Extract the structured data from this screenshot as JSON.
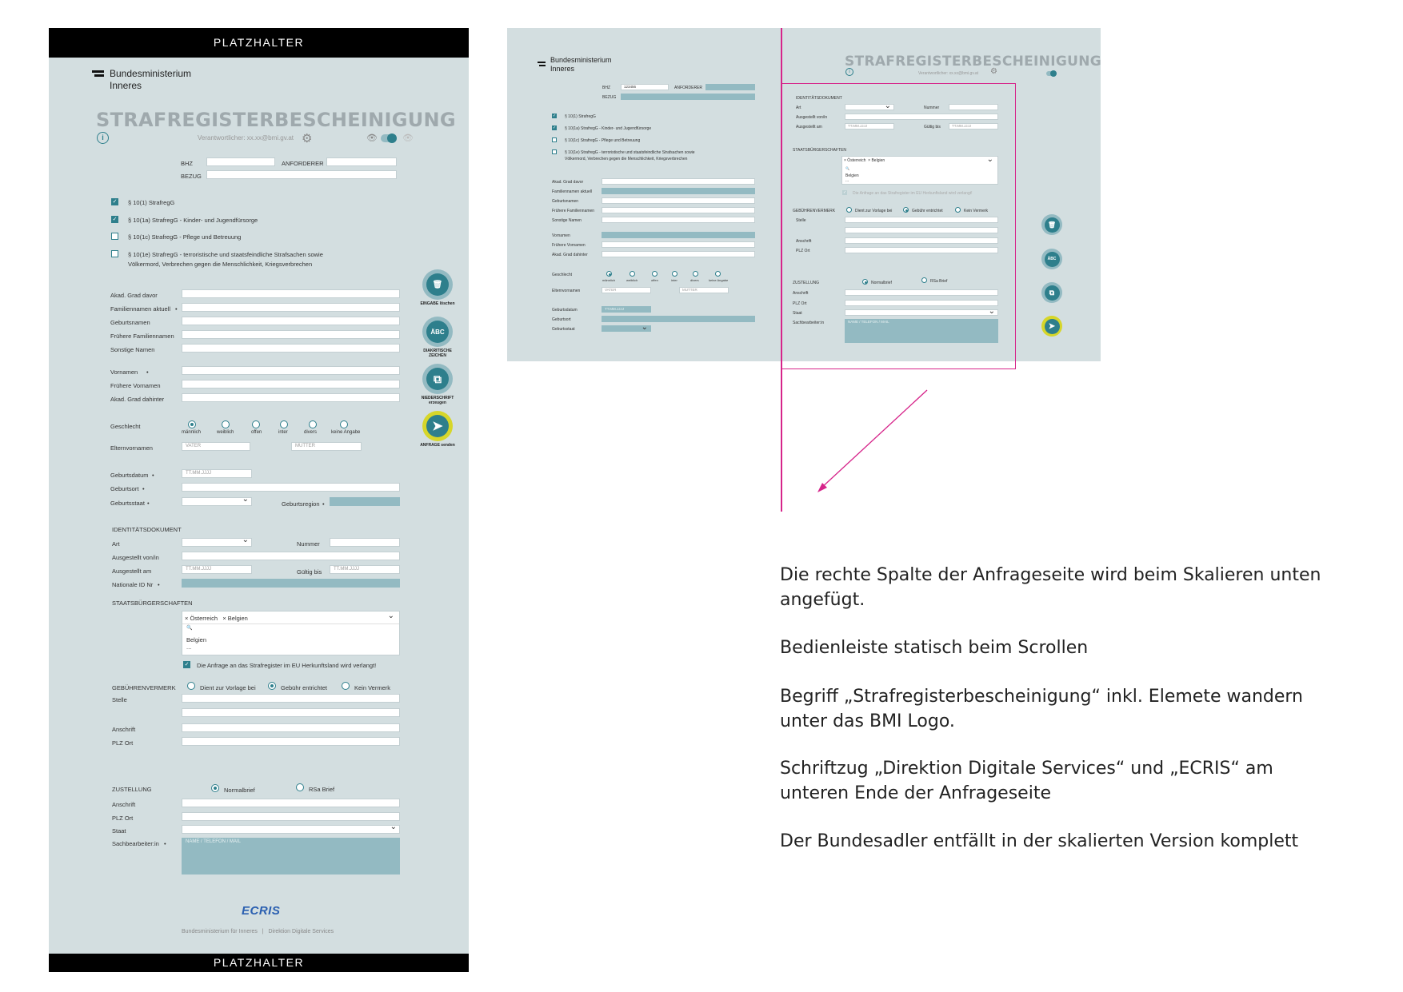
{
  "placeholder_top": "PLATZHALTER",
  "placeholder_bottom": "PLATZHALTER",
  "ministry": {
    "line1": "Bundesministerium",
    "line2": "Inneres"
  },
  "title": "STRAFREGISTERBESCHEINIGUNG",
  "responsible": "Verantwortlicher: xx.xx@bmi.gv.at",
  "small_responsible": "Verantwortlicher: xx.xx@bmi.gv.at",
  "header_fields": {
    "bhz": "BHZ",
    "anforderer": "ANFORDERER",
    "bezug": "BEZUG",
    "bhz_value": "123456"
  },
  "checkboxes": [
    {
      "label": "§ 10(1) StrafregG",
      "checked": true
    },
    {
      "label": "§ 10(1a) StrafregG - Kinder- und Jugendfürsorge",
      "checked": true
    },
    {
      "label": "§ 10(1c) StrafregG - Pflege und Betreuung",
      "checked": false
    },
    {
      "label": "§ 10(1e) StrafregG - terroristische und staatsfeindliche Strafsachen sowie",
      "label2": "Völkermord, Verbrechen gegen die Menschlichkeit, Kriegsverbrechen",
      "checked": false
    }
  ],
  "small_checkboxes": [
    "§ 10(1) StrafregG",
    "§ 10(1a) StrafregG - Kinder- und Jugendfürsorge",
    "§ 10(1c) StrafregG - Pflege und Betreuung",
    "§ 10(1e) StrafregG - terroristische und staatsfeindliche Strafsachen sowie",
    "Völkermord, Verbrechen gegen die Menschlichkeit, Kriegsverbrechen"
  ],
  "name_fields": [
    "Akad. Grad davor",
    "Familiennamen aktuell",
    "Geburtsnamen",
    "Frühere Familiennamen",
    "Sonstige Namen"
  ],
  "vor_fields": [
    "Vornamen",
    "Frühere Vornamen",
    "Akad. Grad dahinter"
  ],
  "gender": {
    "label": "Geschlecht",
    "options": [
      "männlich",
      "weiblich",
      "offen",
      "inter",
      "divers",
      "keine Angabe"
    ]
  },
  "parents": {
    "label": "Elternvornamen",
    "vater": "VATER",
    "mutter": "MUTTER"
  },
  "birth": {
    "datum": "Geburtsdatum",
    "ort": "Geburtsort",
    "staat": "Geburtsstaat",
    "region": "Geburtsregion",
    "placeholder": "TT.MM.JJJJ",
    "small_placeholder": "TT.MM.JJJJ"
  },
  "id_doc": {
    "heading": "IDENTITÄTSDOKUMENT",
    "art": "Art",
    "nummer": "Nummer",
    "von": "Ausgestellt von/in",
    "am": "Ausgestellt am",
    "gueltig": "Gültig bis",
    "nid": "Nationale ID Nr",
    "date_ph": "TT.MM.JJJJ"
  },
  "citizenship": {
    "heading": "STAATSBÜRGERSCHAFTEN",
    "tag1": "× Österreich",
    "tag2": "× Belgien",
    "search": "🔍",
    "option": "Belgien",
    "more": "...",
    "eu_check": "Die Anfrage an das Strafregister im EU Herkunftsland wird verlangt!"
  },
  "fees": {
    "heading": "GEBÜHRENVERMERK",
    "options": [
      "Dient zur Vorlage bei",
      "Gebühr entrichtet",
      "Kein Vermerk"
    ],
    "stelle": "Stelle",
    "anschrift": "Anschrift",
    "plz": "PLZ Ort"
  },
  "delivery": {
    "heading": "ZUSTELLUNG",
    "options": [
      "Normalbrief",
      "RSa Brief"
    ],
    "anschrift": "Anschrift",
    "plz": "PLZ Ort",
    "staat": "Staat",
    "sb": "Sachbearbeiter:in",
    "sb_ph": "NAME / TELEFON / MAIL"
  },
  "actions": [
    {
      "icon": "🗑",
      "label": "EINGABE löschen"
    },
    {
      "icon": "ÄBC",
      "label": "DIAKRITISCHE ZEICHEN"
    },
    {
      "icon": "⧉",
      "label": "NIEDERSCHRIFT erzeugen"
    },
    {
      "icon": "➤",
      "label": "ANFRAGE senden"
    }
  ],
  "footer": {
    "logo": "ECRIS",
    "text1": "Bundesministerium für Inneres",
    "sep": "|",
    "text2": "Direktion Digitale Services"
  },
  "notes": [
    "Die rechte Spalte der Anfrageseite wird beim Skalieren unten angefügt.",
    "Bedienleiste statisch beim Scrollen",
    "Begriff „Strafregisterbescheinigung“ inkl. Elemete wandern unter das BMI Logo.",
    "Schriftzug „Direktion Digitale Services“ und „ECRIS“ am unteren Ende der Anfrageseite",
    "Der Bundesadler entfällt in der skalierten Version komplett"
  ],
  "colors": {
    "panel": "#d3dee0",
    "teal": "#2e7f8c",
    "field_dark": "#93bac2",
    "magenta": "#d6248a",
    "send_ring": "#d6d62a"
  }
}
